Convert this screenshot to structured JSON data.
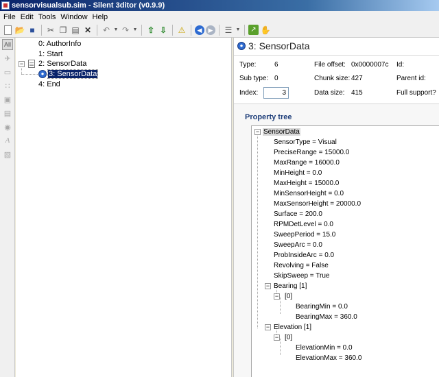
{
  "window": {
    "title": "sensorvisualsub.sim - Silent 3ditor (v0.9.9)"
  },
  "menu": [
    "File",
    "Edit",
    "Tools",
    "Window",
    "Help"
  ],
  "left_strip": {
    "all_label": "All"
  },
  "tree": [
    {
      "label": "0: AuthorInfo"
    },
    {
      "label": "1: Start"
    },
    {
      "label": "2: SensorData"
    },
    {
      "label": "3: SensorData"
    },
    {
      "label": "4: End"
    }
  ],
  "detail": {
    "title": "3: SensorData",
    "type_label": "Type:",
    "type_value": "6",
    "offset_label": "File offset:",
    "offset_value": "0x0000007c",
    "id_label": "Id:",
    "subtype_label": "Sub type:",
    "subtype_value": "0",
    "chunk_label": "Chunk size:",
    "chunk_value": "427",
    "parent_label": "Parent id:",
    "index_label": "Index:",
    "index_value": "3",
    "datasize_label": "Data size:",
    "datasize_value": "415",
    "support_label": "Full support?"
  },
  "property_tree": {
    "title": "Property tree",
    "items": [
      "SensorData",
      "SensorType = Visual",
      "PreciseRange = 15000.0",
      "MaxRange = 16000.0",
      "MinHeight = 0.0",
      "MaxHeight = 15000.0",
      "MinSensorHeight = 0.0",
      "MaxSensorHeight = 20000.0",
      "Surface = 200.0",
      "RPMDetLevel = 0.0",
      "SweepPeriod = 15.0",
      "SweepArc = 0.0",
      "ProbInsideArc = 0.0",
      "Revolving = False",
      "SkipSweep = True",
      "Bearing [1]",
      "[0]",
      "BearingMin = 0.0",
      "BearingMax = 360.0",
      "Elevation [1]",
      "[0]",
      "ElevationMin = 0.0",
      "ElevationMax = 360.0"
    ]
  }
}
